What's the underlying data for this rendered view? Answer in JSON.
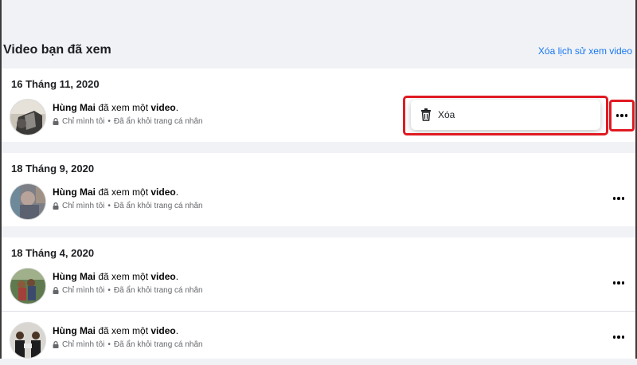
{
  "header": {
    "title": "Video bạn đã xem",
    "clear_history": "Xóa lịch sử xem video"
  },
  "sections": [
    {
      "date": "16 Tháng 11, 2020",
      "entries": [
        {
          "name": "Hùng Mai",
          "action": " đã xem một ",
          "object": "video",
          "end": ".",
          "privacy": "Chỉ mình tôi",
          "separator": "•",
          "visibility": "Đã ẩn khỏi trang cá nhân"
        }
      ]
    },
    {
      "date": "18 Tháng 9, 2020",
      "entries": [
        {
          "name": "Hùng Mai",
          "action": " đã xem một ",
          "object": "video",
          "end": ".",
          "privacy": "Chỉ mình tôi",
          "separator": "•",
          "visibility": "Đã ẩn khỏi trang cá nhân"
        }
      ]
    },
    {
      "date": "18 Tháng 4, 2020",
      "entries": [
        {
          "name": "Hùng Mai",
          "action": " đã xem một ",
          "object": "video",
          "end": ".",
          "privacy": "Chỉ mình tôi",
          "separator": "•",
          "visibility": "Đã ẩn khỏi trang cá nhân"
        },
        {
          "name": "Hùng Mai",
          "action": " đã xem một ",
          "object": "video",
          "end": ".",
          "privacy": "Chỉ mình tôi",
          "separator": "•",
          "visibility": "Đã ẩn khỏi trang cá nhân"
        }
      ]
    }
  ],
  "dropdown": {
    "delete_label": "Xóa",
    "icon": "trash-icon"
  },
  "colors": {
    "accent": "#1877f2",
    "highlight": "#e01a22",
    "background": "#f0f2f5"
  }
}
